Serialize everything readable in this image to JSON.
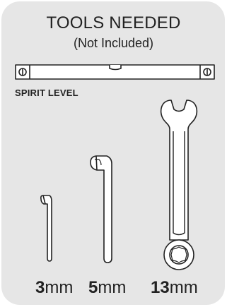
{
  "title": "TOOLS NEEDED",
  "subtitle": "(Not Included)",
  "tools": {
    "level_label": "SPIRIT LEVEL",
    "hex_3": {
      "number": "3",
      "unit": "mm"
    },
    "hex_5": {
      "number": "5",
      "unit": "mm"
    },
    "wrench_13": {
      "number": "13",
      "unit": "mm"
    }
  },
  "colors": {
    "card": "#e6e6e6",
    "outline": "#222222",
    "tool_fill": "#ffffff"
  }
}
